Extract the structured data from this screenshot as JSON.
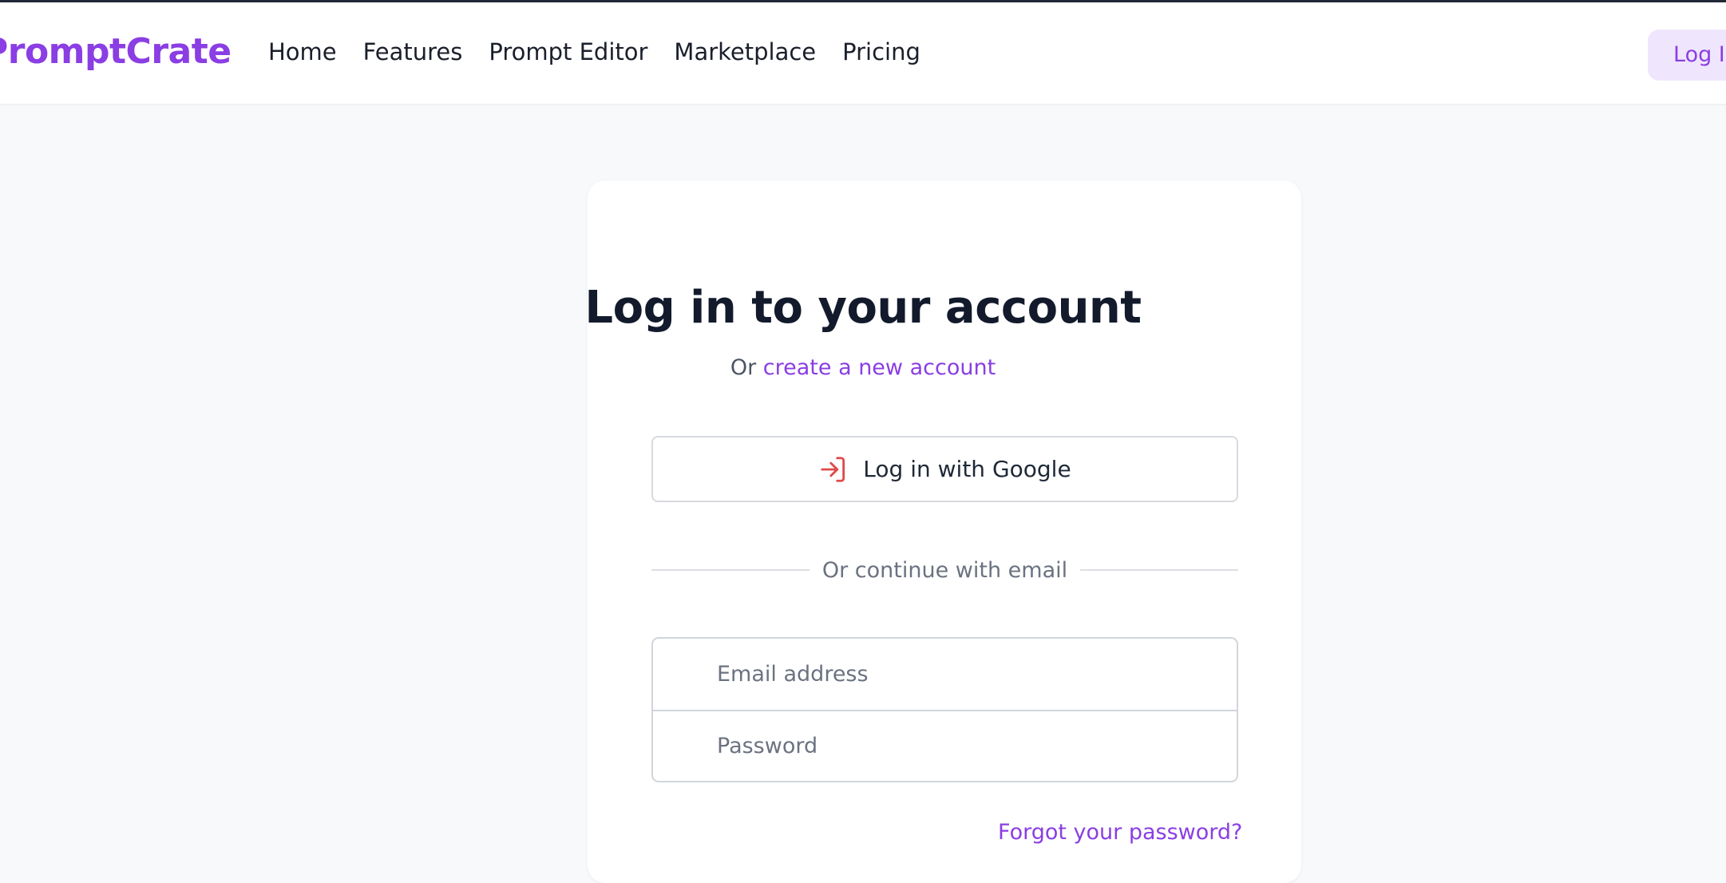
{
  "header": {
    "brand": "PromptCrate",
    "nav": [
      {
        "label": "Home"
      },
      {
        "label": "Features"
      },
      {
        "label": "Prompt Editor"
      },
      {
        "label": "Marketplace"
      },
      {
        "label": "Pricing"
      }
    ],
    "login_button": "Log In"
  },
  "login_card": {
    "title": "Log in to your account",
    "subtitle_prefix": "Or",
    "subtitle_link": "create a new account",
    "google_button": {
      "label": "Log in with Google",
      "icon": "login-arrow-icon",
      "icon_color": "#e04a4a"
    },
    "divider_text": "Or continue with email",
    "email_placeholder": "Email address",
    "password_placeholder": "Password",
    "forgot_link": "Forgot your password?"
  },
  "colors": {
    "brand": "#8a3ee3",
    "page_background": "#f8f9fb",
    "heading": "#121a2c",
    "muted_text": "#6b7280"
  }
}
